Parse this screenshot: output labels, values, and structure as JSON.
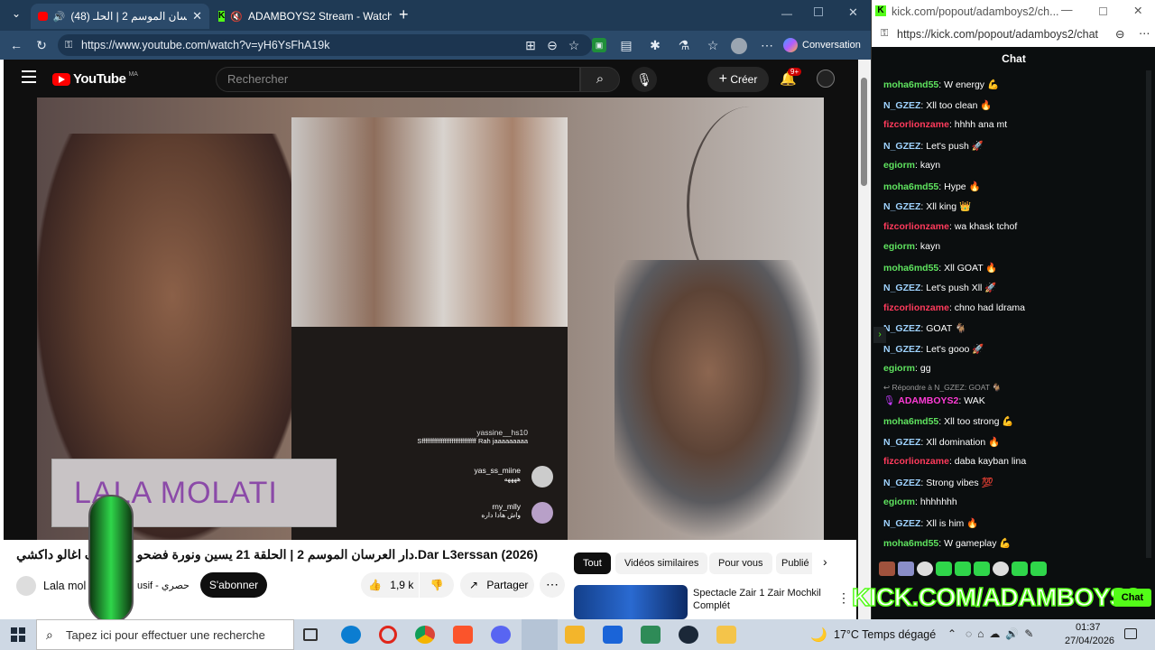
{
  "browser": {
    "tabs": [
      {
        "title": "(48) دار العرسان الموسم 2 | الحلـ",
        "active": true
      },
      {
        "title": "ADAMBOYS2 Stream - Watch",
        "active": false
      }
    ],
    "url": "https://www.youtube.com/watch?v=yH6YsFhA19k",
    "copilot_label": "Conversation"
  },
  "youtube": {
    "logo": "YouTube",
    "region": "MA",
    "search_placeholder": "Rechercher",
    "create_label": "Créer",
    "notif_badge": "9+",
    "video_overlay_text": "LALA MOLATI",
    "video_comments": [
      {
        "user": "yassine__hs10",
        "text": "Sfffffffffffffffffffffffffffffff Rah jaaaaaaaaa"
      },
      {
        "user": "yas_ss_miine",
        "text": "ههههه"
      },
      {
        "user": "rny_mlly",
        "text": "واش هادا داره"
      }
    ],
    "video_title": "Dar L3erssan (2026).دار العرسان الموسم 2 | الحلقة 21 يسين ونورة فضحو كلشي ف اغالو داكشي لي",
    "channel_name": "Lala mol",
    "channel_suffix": "usif - حصري",
    "subscribe_label": "S'abonner",
    "likes": "1,9 k",
    "share_label": "Partager",
    "chips": [
      "Tout",
      "Vidéos similaires",
      "Pour vous",
      "Publié"
    ],
    "suggestion_title": "Spectacle Zair 1 Zair Mochkil Complét"
  },
  "kick": {
    "title_url": "kick.com/popout/adamboys2/ch...",
    "url": "https://kick.com/popout/adamboys2/chat",
    "chat_header": "Chat",
    "watermark": "KICK.COM/ADAMBOYS2",
    "chat_button": "Chat",
    "messages": [
      {
        "user": "moha6md55",
        "text": "W energy 💪",
        "color": "#5fe35f"
      },
      {
        "user": "N_GZEZ",
        "text": "Xll too clean 🔥",
        "color": "#9fd3ff"
      },
      {
        "user": "fizcorlionzame",
        "text": "hhhh ana mt",
        "color": "#ff3b5c"
      },
      {
        "user": "N_GZEZ",
        "text": "Let's push 🚀",
        "color": "#9fd3ff"
      },
      {
        "user": "egiorm",
        "text": "kayn",
        "color": "#5fe35f"
      },
      {
        "user": "moha6md55",
        "text": "Hype 🔥",
        "color": "#5fe35f"
      },
      {
        "user": "N_GZEZ",
        "text": "Xll king 👑",
        "color": "#9fd3ff"
      },
      {
        "user": "fizcorlionzame",
        "text": "wa khask tchof",
        "color": "#ff3b5c"
      },
      {
        "user": "egiorm",
        "text": "kayn",
        "color": "#5fe35f"
      },
      {
        "user": "moha6md55",
        "text": "Xll GOAT 🔥",
        "color": "#5fe35f"
      },
      {
        "user": "N_GZEZ",
        "text": "Let's push Xll 🚀",
        "color": "#9fd3ff"
      },
      {
        "user": "fizcorlionzame",
        "text": "chno had ldrama",
        "color": "#ff3b5c"
      },
      {
        "user": "N_GZEZ",
        "text": "GOAT 🐐",
        "color": "#9fd3ff"
      },
      {
        "user": "N_GZEZ",
        "text": "Let's gooo 🚀",
        "color": "#9fd3ff"
      },
      {
        "user": "egiorm",
        "text": "gg",
        "color": "#5fe35f"
      }
    ],
    "reply_label": "Répondre à N_GZEZ: GOAT 🐐",
    "reply_message": {
      "user": "ADAMBOYS2",
      "text": "WAK",
      "color": "#ff3bd6"
    },
    "messages2": [
      {
        "user": "moha6md55",
        "text": "Xll too strong 💪",
        "color": "#5fe35f"
      },
      {
        "user": "N_GZEZ",
        "text": "Xll domination 🔥",
        "color": "#9fd3ff"
      },
      {
        "user": "fizcorlionzame",
        "text": "daba kayban lina",
        "color": "#ff3b5c"
      },
      {
        "user": "N_GZEZ",
        "text": "Strong vibes 💯",
        "color": "#9fd3ff"
      },
      {
        "user": "egiorm",
        "text": "hhhhhhh",
        "color": "#5fe35f"
      },
      {
        "user": "N_GZEZ",
        "text": "Xll is him 🔥",
        "color": "#9fd3ff"
      },
      {
        "user": "moha6md55",
        "text": "W gameplay 💪",
        "color": "#5fe35f"
      }
    ]
  },
  "taskbar": {
    "search_placeholder": "Tapez ici pour effectuer une recherche",
    "weather": "17°C  Temps dégagé",
    "time": "01:37",
    "date": "27/04/2026"
  }
}
